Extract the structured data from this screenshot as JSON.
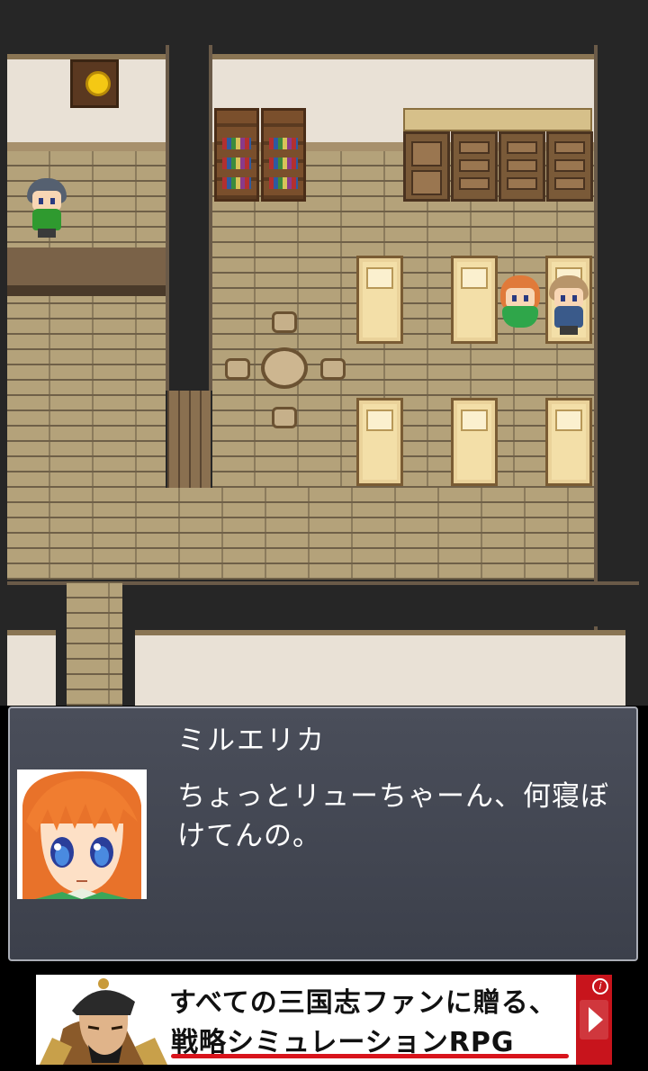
{
  "dialog": {
    "speaker": "ミルエリカ",
    "message": "ちょっとリューちゃーん、何寝ぼけてんの。"
  },
  "ad": {
    "line1": "すべての三国志ファンに贈る、",
    "line2": "戦略シミュレーションRPG",
    "info_symbol": "i",
    "play_icon": "play-triangle-icon",
    "accent_color": "#c8141c"
  },
  "map": {
    "characters": [
      {
        "name": "shopkeeper",
        "hair": "#556070",
        "shirt": "#2f9a2f"
      },
      {
        "name": "milerica",
        "hair": "#e07a3a",
        "shirt": "#2fa64a"
      },
      {
        "name": "ryu",
        "hair": "#b8956a",
        "shirt": "#3a5a8a"
      }
    ]
  }
}
